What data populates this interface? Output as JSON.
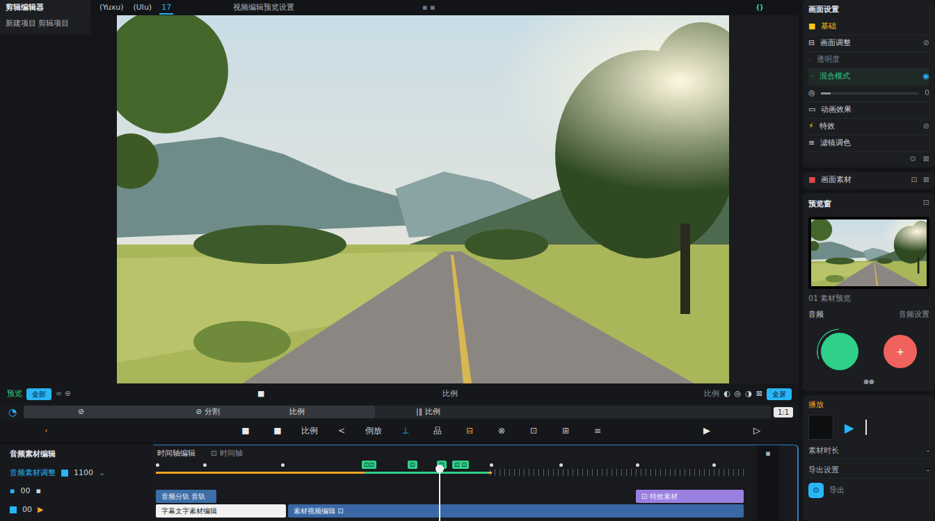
{
  "app": {
    "title": "剪辑编辑器",
    "subtitle": "新建项目 剪辑项目"
  },
  "top_tabs": [
    {
      "label": "(Yuxu)",
      "selected": false
    },
    {
      "label": "(Ulu)",
      "selected": false
    },
    {
      "label": "17",
      "selected": true
    }
  ],
  "center_title": "视频编辑预览设置",
  "top_dots": "▪ ▪",
  "top_right_icon": "()",
  "preview_bar": {
    "left_label": "预览",
    "left_badge": "全部",
    "left_icons": "∞ ⊕",
    "center_icon": "■",
    "center_label": "比例",
    "right_label": "比例",
    "right_icons": [
      "◐",
      "◎",
      "◑",
      "⊠"
    ],
    "right_badge": "全屏"
  },
  "scrub": {
    "icon": "◔",
    "level": 0.47,
    "labels": [
      "⊘",
      "⊘ 分割",
      "比例",
      "|‖ 比例"
    ],
    "badge": "1:1"
  },
  "toolbar": {
    "left_icon": "‹",
    "items": [
      {
        "label": "■",
        "color": "#e8e8e8"
      },
      {
        "label": "■",
        "color": "#e8e8e8"
      },
      {
        "label": "比例",
        "color": "#c8ccd2"
      },
      {
        "label": "<",
        "color": "#c8ccd2"
      },
      {
        "label": "倒放",
        "color": "#c8ccd2"
      },
      {
        "label": "⊥",
        "color": "#29b6f6"
      },
      {
        "label": "品",
        "color": "#c8ccd2"
      },
      {
        "label": "⊟",
        "color": "#f5a623"
      },
      {
        "label": "⊗",
        "color": "#c8ccd2"
      },
      {
        "label": "⊡",
        "color": "#c8ccd2"
      },
      {
        "label": "⊞",
        "color": "#c8ccd2"
      },
      {
        "label": "≡",
        "color": "#c8ccd2"
      }
    ],
    "play": "▶",
    "next": "▷"
  },
  "media_panel": {
    "title": "音频素材编辑",
    "adjust_label": "音频素材调整",
    "adjust_value": "1100",
    "adjust_caret": "⌄",
    "row_a": [
      "▪",
      "00",
      "▪"
    ],
    "row_b": [
      "00",
      "▶"
    ]
  },
  "timeline": {
    "title": "时间轴编辑",
    "view": "⊡ 时间轴",
    "scroll_icon": "▪",
    "progress": {
      "level": 0.57
    },
    "playhead": {
      "level": 0.48
    },
    "tags": [
      {
        "label": "⊡⊡"
      },
      {
        "label": "⊡"
      },
      {
        "label": "⊡"
      },
      {
        "label": "⊡ ⊡"
      }
    ],
    "tracks": [
      {
        "clips": [
          {
            "label": "音频分轨 音轨",
            "color": "#3c6ea8"
          },
          {
            "label": "⊡ 特效素材",
            "color": "#9b7fe0"
          }
        ]
      },
      {
        "clips": [
          {
            "label": "字幕文字素材编辑",
            "color": "#f2f2f2"
          },
          {
            "label": "素材视频编辑 ⊡",
            "color": "#3a68a6"
          }
        ]
      }
    ]
  },
  "properties": {
    "title": "画面设置",
    "items": [
      {
        "kind": "tab",
        "icon": "■",
        "label": "基础"
      },
      {
        "kind": "row",
        "icon": "⊟",
        "label": "画面调整",
        "right": "⊘"
      },
      {
        "kind": "plain",
        "icon": "·",
        "label": "透明度"
      },
      {
        "kind": "select",
        "icon": "·",
        "label": "混合模式",
        "right": "◉"
      },
      {
        "kind": "slider",
        "icon": "◎",
        "label": "0",
        "level": 0.1
      },
      {
        "kind": "row",
        "icon": "▭",
        "label": "动画效果"
      },
      {
        "kind": "accent",
        "icon": "⚡",
        "label": "特效",
        "right": "⊘"
      },
      {
        "kind": "row",
        "icon": "≡",
        "label": "滤镜调色"
      }
    ],
    "footer": [
      "⊙",
      "⊠"
    ]
  },
  "material": {
    "icon": "■",
    "label": "画面素材",
    "actions": [
      "⊡",
      "⊠"
    ]
  },
  "preview_card": {
    "title": "预览窗",
    "action": "⊡",
    "caption": "01 素材预览",
    "left": "音频",
    "right": "音频设置",
    "record": {
      "color": "#2fd08a",
      "level": 0.3
    },
    "stop": {
      "label": "+",
      "color": "#f0625d"
    },
    "dots": "●●"
  },
  "playback": {
    "title": "播放",
    "play": "▶",
    "rows": [
      {
        "label": "素材时长",
        "value": "-"
      },
      {
        "label": "导出设置",
        "value": "-"
      }
    ],
    "export": {
      "icon": "⊙",
      "label": "导出"
    }
  }
}
